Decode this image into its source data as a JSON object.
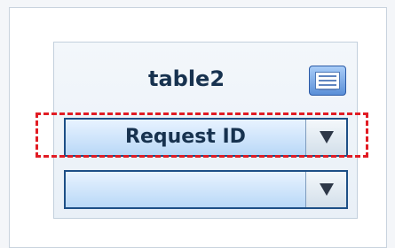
{
  "panel": {
    "title": "table2",
    "table_icon": "table-list-icon"
  },
  "fields": [
    {
      "value": "Request ID",
      "arrow_icon": "dropdown-arrow-icon"
    },
    {
      "value": "",
      "arrow_icon": "dropdown-arrow-icon"
    }
  ],
  "highlight": {
    "color": "#e11c24",
    "style": "dashed"
  }
}
